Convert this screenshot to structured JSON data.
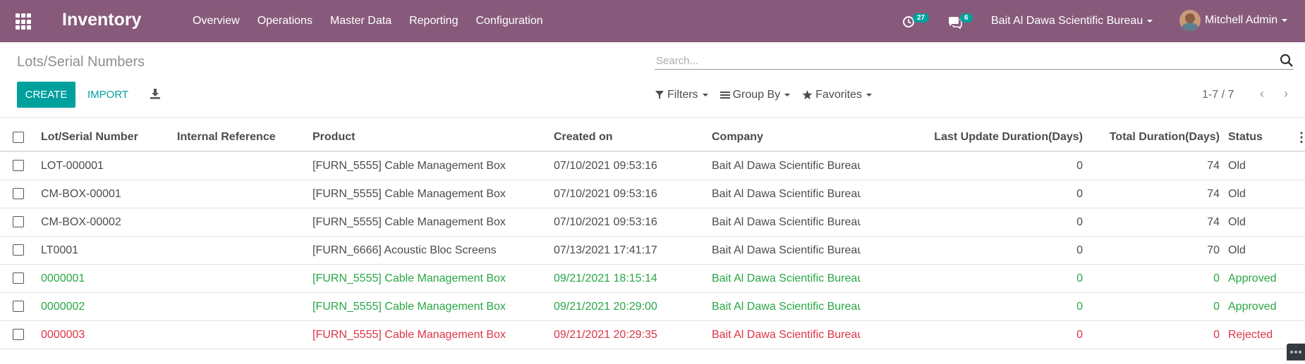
{
  "navbar": {
    "app_name": "Inventory",
    "menu": [
      "Overview",
      "Operations",
      "Master Data",
      "Reporting",
      "Configuration"
    ],
    "activity_count": "27",
    "message_count": "6",
    "company": "Bait Al Dawa Scientific Bureau",
    "user": "Mitchell Admin"
  },
  "control_panel": {
    "title": "Lots/Serial Numbers",
    "search_placeholder": "Search...",
    "create_label": "CREATE",
    "import_label": "IMPORT",
    "filters_label": "Filters",
    "groupby_label": "Group By",
    "favorites_label": "Favorites",
    "pager": "1-7 / 7"
  },
  "table": {
    "columns": [
      "Lot/Serial Number",
      "Internal Reference",
      "Product",
      "Created on",
      "Company",
      "Last Update Duration(Days)",
      "Total Duration(Days)",
      "Status"
    ],
    "rows": [
      {
        "lot": "LOT-000001",
        "ref": "",
        "product": "[FURN_5555] Cable Management Box",
        "created": "07/10/2021 09:53:16",
        "company": "Bait Al Dawa Scientific Bureau",
        "last": "0",
        "total": "74",
        "status": "Old"
      },
      {
        "lot": "CM-BOX-00001",
        "ref": "",
        "product": "[FURN_5555] Cable Management Box",
        "created": "07/10/2021 09:53:16",
        "company": "Bait Al Dawa Scientific Bureau",
        "last": "0",
        "total": "74",
        "status": "Old"
      },
      {
        "lot": "CM-BOX-00002",
        "ref": "",
        "product": "[FURN_5555] Cable Management Box",
        "created": "07/10/2021 09:53:16",
        "company": "Bait Al Dawa Scientific Bureau",
        "last": "0",
        "total": "74",
        "status": "Old"
      },
      {
        "lot": "LT0001",
        "ref": "",
        "product": "[FURN_6666] Acoustic Bloc Screens",
        "created": "07/13/2021 17:41:17",
        "company": "Bait Al Dawa Scientific Bureau",
        "last": "0",
        "total": "70",
        "status": "Old"
      },
      {
        "lot": "0000001",
        "ref": "",
        "product": "[FURN_5555] Cable Management Box",
        "created": "09/21/2021 18:15:14",
        "company": "Bait Al Dawa Scientific Bureau",
        "last": "0",
        "total": "0",
        "status": "Approved"
      },
      {
        "lot": "0000002",
        "ref": "",
        "product": "[FURN_5555] Cable Management Box",
        "created": "09/21/2021 20:29:00",
        "company": "Bait Al Dawa Scientific Bureau",
        "last": "0",
        "total": "0",
        "status": "Approved"
      },
      {
        "lot": "0000003",
        "ref": "",
        "product": "[FURN_5555] Cable Management Box",
        "created": "09/21/2021 20:29:35",
        "company": "Bait Al Dawa Scientific Bureau",
        "last": "0",
        "total": "0",
        "status": "Rejected"
      }
    ]
  },
  "colors": {
    "navbar": "#875a7b",
    "primary": "#00a09d",
    "approved": "#28a745",
    "rejected": "#dc3545"
  }
}
